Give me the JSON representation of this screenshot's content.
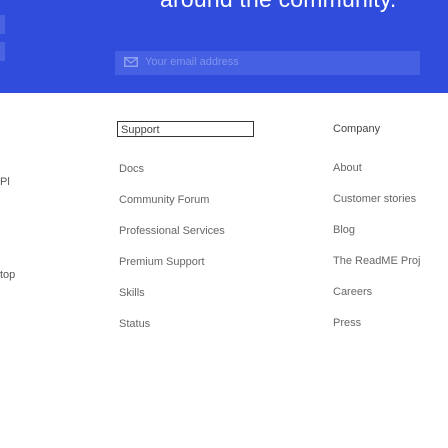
{
  "hero": {
    "heading": "around the community.",
    "email_placeholder": "Your email address"
  },
  "edge_labels": {
    "first": "Pl",
    "second": "top"
  },
  "support_column": {
    "heading": "Support",
    "links": [
      "Docs",
      "Community Forum",
      "Professional Services",
      "Premium Support",
      "Skills",
      "Status"
    ]
  },
  "company_column": {
    "heading": "Company",
    "links": [
      "About",
      "Customer stories",
      "Blog",
      "The ReadME Proj",
      "Careers",
      "Press"
    ]
  },
  "colors": {
    "hero_background": "#2f4cdc",
    "input_background": "#4560e2",
    "link_text": "#666666"
  },
  "icons": {
    "email": "mail-icon"
  }
}
